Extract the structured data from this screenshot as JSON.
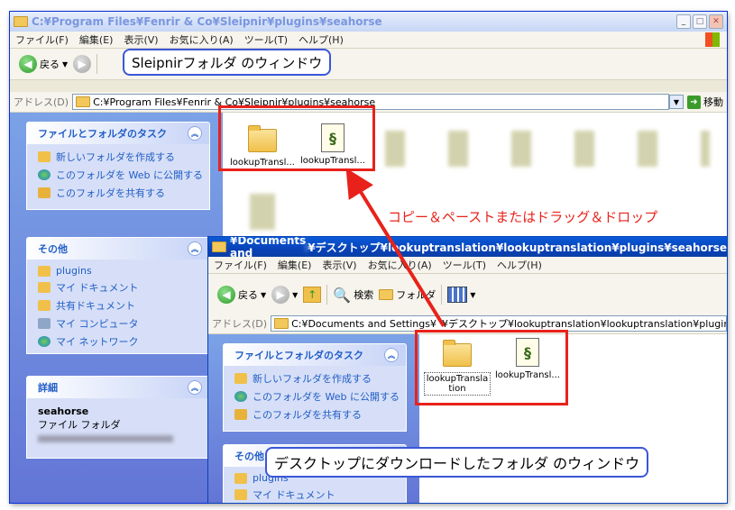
{
  "back_window": {
    "title": "C:¥Program Files¥Fenrir & Co¥Sleipnir¥plugins¥seahorse",
    "menu": [
      "ファイル(F)",
      "編集(E)",
      "表示(V)",
      "お気に入り(A)",
      "ツール(T)",
      "ヘルプ(H)"
    ],
    "toolbar": {
      "back": "戻る"
    },
    "address": {
      "label": "アドレス(D)",
      "path": "C:¥Program Files¥Fenrir & Co¥Sleipnir¥plugins¥seahorse",
      "go": "移動"
    },
    "tasks_panel": {
      "title": "ファイルとフォルダのタスク",
      "items": [
        "新しいフォルダを作成する",
        "このフォルダを Web に公開する",
        "このフォルダを共有する"
      ]
    },
    "other_panel": {
      "title": "その他",
      "items": [
        "plugins",
        "マイ ドキュメント",
        "共有ドキュメント",
        "マイ コンピュータ",
        "マイ ネットワーク"
      ]
    },
    "details_panel": {
      "title": "詳細",
      "name": "seahorse",
      "type": "ファイル フォルダ"
    },
    "files": [
      "lookupTransl...",
      "lookupTransl..."
    ]
  },
  "front_window": {
    "title": "C:¥Documents and Settings¥",
    "title_suffix": "¥デスクトップ¥lookuptranslation¥lookuptranslation¥plugins¥seahorse",
    "menu": [
      "ファイル(F)",
      "編集(E)",
      "表示(V)",
      "お気に入り(A)",
      "ツール(T)",
      "ヘルプ(H)"
    ],
    "toolbar": {
      "back": "戻る",
      "search": "検索",
      "folders": "フォルダ"
    },
    "address": {
      "label": "アドレス(D)",
      "path": "C:¥Documents and Settings¥",
      "path_suffix": "¥デスクトップ¥lookuptranslation¥lookuptranslation¥plugins¥sea"
    },
    "tasks_panel": {
      "title": "ファイルとフォルダのタスク",
      "items": [
        "新しいフォルダを作成する",
        "このフォルダを Web に公開する",
        "このフォルダを共有する"
      ]
    },
    "other_panel": {
      "title": "その他",
      "items": [
        "plugins",
        "マイ ドキュメント"
      ]
    },
    "files": [
      "lookupTranslation",
      "lookupTransl..."
    ]
  },
  "annotations": {
    "back_callout": "Sleipnirフォルダ のウィンドウ",
    "front_callout": "デスクトップにダウンロードしたフォルダ のウィンドウ",
    "action": "コピー＆ペーストまたはドラッグ＆ドロップ"
  },
  "colors": {
    "annotation_red": "#e8221b",
    "callout_blue": "#3a57d6",
    "xp_blue": "#0842b8"
  }
}
